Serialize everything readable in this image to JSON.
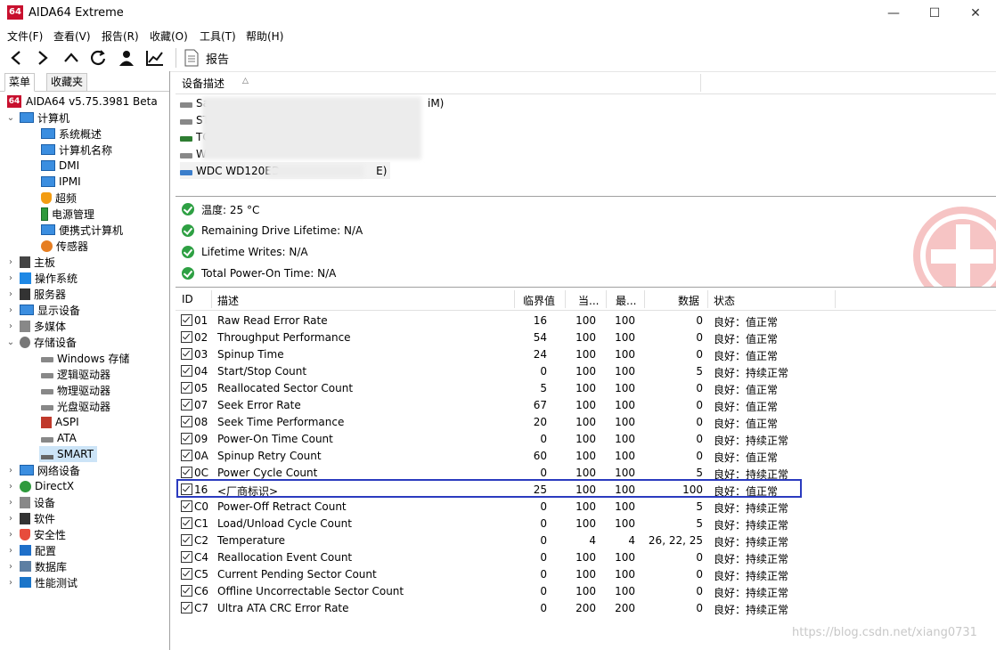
{
  "window": {
    "title": "AIDA64 Extreme",
    "app_icon": "64",
    "minimize": "—",
    "maximize": "☐",
    "close": "✕"
  },
  "menu": [
    "文件(F)",
    "查看(V)",
    "报告(R)",
    "收藏(O)",
    "工具(T)",
    "帮助(H)"
  ],
  "toolbar": {
    "report_label": "报告"
  },
  "tabs": {
    "menu": "菜单",
    "favorites": "收藏夹"
  },
  "tree": {
    "root": "AIDA64 v5.75.3981 Beta",
    "items": [
      {
        "label": "计算机",
        "expanded": true,
        "icon": "computer-icon"
      },
      {
        "label": "系统概述",
        "icon": "monitor-icon"
      },
      {
        "label": "计算机名称",
        "icon": "monitor-icon"
      },
      {
        "label": "DMI",
        "icon": "monitor-icon"
      },
      {
        "label": "IPMI",
        "icon": "monitor-icon"
      },
      {
        "label": "超频",
        "icon": "flame-icon"
      },
      {
        "label": "电源管理",
        "icon": "battery-icon"
      },
      {
        "label": "便携式计算机",
        "icon": "laptop-icon"
      },
      {
        "label": "传感器",
        "icon": "sensor-icon"
      },
      {
        "label": "主板",
        "icon": "motherboard-icon"
      },
      {
        "label": "操作系统",
        "icon": "windows-icon"
      },
      {
        "label": "服务器",
        "icon": "server-icon"
      },
      {
        "label": "显示设备",
        "icon": "display-icon"
      },
      {
        "label": "多媒体",
        "icon": "speaker-icon"
      },
      {
        "label": "存储设备",
        "expanded": true,
        "icon": "storage-icon"
      },
      {
        "label": "Windows 存储",
        "icon": "drive-icon"
      },
      {
        "label": "逻辑驱动器",
        "icon": "drive-icon"
      },
      {
        "label": "物理驱动器",
        "icon": "drive-icon"
      },
      {
        "label": "光盘驱动器",
        "icon": "optical-icon"
      },
      {
        "label": "ASPI",
        "icon": "aspi-icon"
      },
      {
        "label": "ATA",
        "icon": "drive-icon"
      },
      {
        "label": "SMART",
        "icon": "smart-icon",
        "selected": true
      },
      {
        "label": "网络设备",
        "icon": "network-icon"
      },
      {
        "label": "DirectX",
        "icon": "xbox-icon"
      },
      {
        "label": "设备",
        "icon": "device-icon"
      },
      {
        "label": "软件",
        "icon": "software-icon"
      },
      {
        "label": "安全性",
        "icon": "shield-icon"
      },
      {
        "label": "配置",
        "icon": "config-icon"
      },
      {
        "label": "数据库",
        "icon": "database-icon"
      },
      {
        "label": "性能测试",
        "icon": "benchmark-icon"
      }
    ]
  },
  "devices": {
    "header": "设备描述",
    "sort_indicator": "△",
    "rows": [
      {
        "prefix": "Sa",
        "suffix": "iM)"
      },
      {
        "prefix": "ST",
        "suffix": ""
      },
      {
        "prefix": "TO",
        "suffix": ""
      },
      {
        "prefix": "W",
        "suffix": ""
      },
      {
        "prefix": "WDC WD120ED",
        "suffix": "E)"
      }
    ]
  },
  "status": [
    "温度: 25 °C",
    "Remaining Drive Lifetime: N/A",
    "Lifetime Writes: N/A",
    "Total Power-On Time: N/A"
  ],
  "smart_table": {
    "headers": [
      "ID",
      "描述",
      "临界值",
      "当...",
      "最...",
      "数据",
      "状态"
    ],
    "rows": [
      {
        "id": "01",
        "desc": "Raw Read Error Rate",
        "threshold": "16",
        "current": "100",
        "worst": "100",
        "data": "0",
        "status": "良好：值正常"
      },
      {
        "id": "02",
        "desc": "Throughput Performance",
        "threshold": "54",
        "current": "100",
        "worst": "100",
        "data": "0",
        "status": "良好：值正常"
      },
      {
        "id": "03",
        "desc": "Spinup Time",
        "threshold": "24",
        "current": "100",
        "worst": "100",
        "data": "0",
        "status": "良好：值正常"
      },
      {
        "id": "04",
        "desc": "Start/Stop Count",
        "threshold": "0",
        "current": "100",
        "worst": "100",
        "data": "5",
        "status": "良好：持续正常"
      },
      {
        "id": "05",
        "desc": "Reallocated Sector Count",
        "threshold": "5",
        "current": "100",
        "worst": "100",
        "data": "0",
        "status": "良好：值正常"
      },
      {
        "id": "07",
        "desc": "Seek Error Rate",
        "threshold": "67",
        "current": "100",
        "worst": "100",
        "data": "0",
        "status": "良好：值正常"
      },
      {
        "id": "08",
        "desc": "Seek Time Performance",
        "threshold": "20",
        "current": "100",
        "worst": "100",
        "data": "0",
        "status": "良好：值正常"
      },
      {
        "id": "09",
        "desc": "Power-On Time Count",
        "threshold": "0",
        "current": "100",
        "worst": "100",
        "data": "0",
        "status": "良好：持续正常"
      },
      {
        "id": "0A",
        "desc": "Spinup Retry Count",
        "threshold": "60",
        "current": "100",
        "worst": "100",
        "data": "0",
        "status": "良好：值正常"
      },
      {
        "id": "0C",
        "desc": "Power Cycle Count",
        "threshold": "0",
        "current": "100",
        "worst": "100",
        "data": "5",
        "status": "良好：持续正常"
      },
      {
        "id": "16",
        "desc": "<厂商标识>",
        "threshold": "25",
        "current": "100",
        "worst": "100",
        "data": "100",
        "status": "良好：值正常"
      },
      {
        "id": "C0",
        "desc": "Power-Off Retract Count",
        "threshold": "0",
        "current": "100",
        "worst": "100",
        "data": "5",
        "status": "良好：持续正常"
      },
      {
        "id": "C1",
        "desc": "Load/Unload Cycle Count",
        "threshold": "0",
        "current": "100",
        "worst": "100",
        "data": "5",
        "status": "良好：持续正常"
      },
      {
        "id": "C2",
        "desc": "Temperature",
        "threshold": "0",
        "current": "4",
        "worst": "4",
        "data": "26, 22, 25",
        "status": "良好：持续正常"
      },
      {
        "id": "C4",
        "desc": "Reallocation Event Count",
        "threshold": "0",
        "current": "100",
        "worst": "100",
        "data": "0",
        "status": "良好：持续正常"
      },
      {
        "id": "C5",
        "desc": "Current Pending Sector Count",
        "threshold": "0",
        "current": "100",
        "worst": "100",
        "data": "0",
        "status": "良好：持续正常"
      },
      {
        "id": "C6",
        "desc": "Offline Uncorrectable Sector Count",
        "threshold": "0",
        "current": "100",
        "worst": "100",
        "data": "0",
        "status": "良好：持续正常"
      },
      {
        "id": "C7",
        "desc": "Ultra ATA CRC Error Rate",
        "threshold": "0",
        "current": "200",
        "worst": "200",
        "data": "0",
        "status": "良好：持续正常"
      }
    ]
  },
  "watermark": "https://blog.csdn.net/xiang0731",
  "colors": {
    "highlight": "#2b3bbf",
    "ok_green": "#2ea043",
    "logo_red": "#c8102e",
    "selected": "#cce4f7"
  }
}
